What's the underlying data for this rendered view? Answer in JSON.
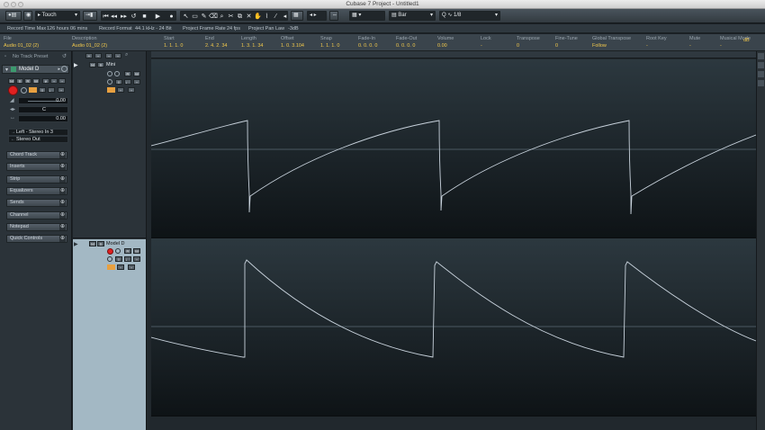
{
  "window": {
    "title": "Cubase 7 Project - Untitled1"
  },
  "toolbar": {
    "automation_mode": "Touch",
    "grid_type": "Bar",
    "quantize": "1/8"
  },
  "status": {
    "record_time_max_label": "Record Time Max",
    "record_time_max_value": "126 hours 06 mins",
    "record_format_label": "Record Format",
    "record_format_value": "44.1 kHz - 24 Bit",
    "frame_rate_label": "Project Frame Rate",
    "frame_rate_value": "24 fps",
    "pan_law_label": "Project Pan Law",
    "pan_law_value": "-3dB"
  },
  "info_line": [
    {
      "label": "File",
      "value": "Audio 01_02 (2)"
    },
    {
      "label": "Description",
      "value": "Audio 01_02 (2)"
    },
    {
      "label": "Start",
      "value": "1. 1. 1.   0"
    },
    {
      "label": "End",
      "value": "2. 4. 2.  34"
    },
    {
      "label": "Length",
      "value": "1. 3. 1.  34"
    },
    {
      "label": "Offset",
      "value": "1. 0. 3.104"
    },
    {
      "label": "Snap",
      "value": "1. 1. 1.   0"
    },
    {
      "label": "Fade-In",
      "value": "0. 0. 0.   0"
    },
    {
      "label": "Fade-Out",
      "value": "0. 0. 0.   0"
    },
    {
      "label": "Volume",
      "value": "0.00"
    },
    {
      "label": "Lock",
      "value": "-"
    },
    {
      "label": "Transpose",
      "value": "0"
    },
    {
      "label": "Fine-Tune",
      "value": "0"
    },
    {
      "label": "Global Transpose",
      "value": "Follow"
    },
    {
      "label": "Root Key",
      "value": "-"
    },
    {
      "label": "Mute",
      "value": "-"
    },
    {
      "label": "Musical Mode",
      "value": "-"
    },
    {
      "label": "",
      "value": "dB"
    }
  ],
  "inspector": {
    "preset": "No Track Preset",
    "track_name": "Model D",
    "volume_value": "0.00",
    "pan_value": "C",
    "delay_value": "0.00",
    "input": "Left - Stereo In 3",
    "output": "Stereo Out",
    "sections": [
      "Chord Track",
      "Inserts",
      "Strip",
      "Equalizers",
      "Sends",
      "Channel",
      "Notepad",
      "Quick Controls"
    ]
  },
  "tracks": [
    {
      "name": "Mini"
    },
    {
      "name": "Model D"
    }
  ],
  "colors": {
    "accent_orange": "#e8a040",
    "record_red": "#e02020",
    "highlight_yellow": "#f2c94c",
    "waveform": "#c8d2dc"
  },
  "icons": [
    "close-icon",
    "minimize-icon",
    "zoom-icon",
    "play-icon",
    "stop-icon",
    "record-icon",
    "pointer-icon",
    "pencil-icon",
    "scissors-icon",
    "glue-icon",
    "eraser-icon",
    "magnify-icon",
    "snap-icon",
    "search-icon"
  ]
}
